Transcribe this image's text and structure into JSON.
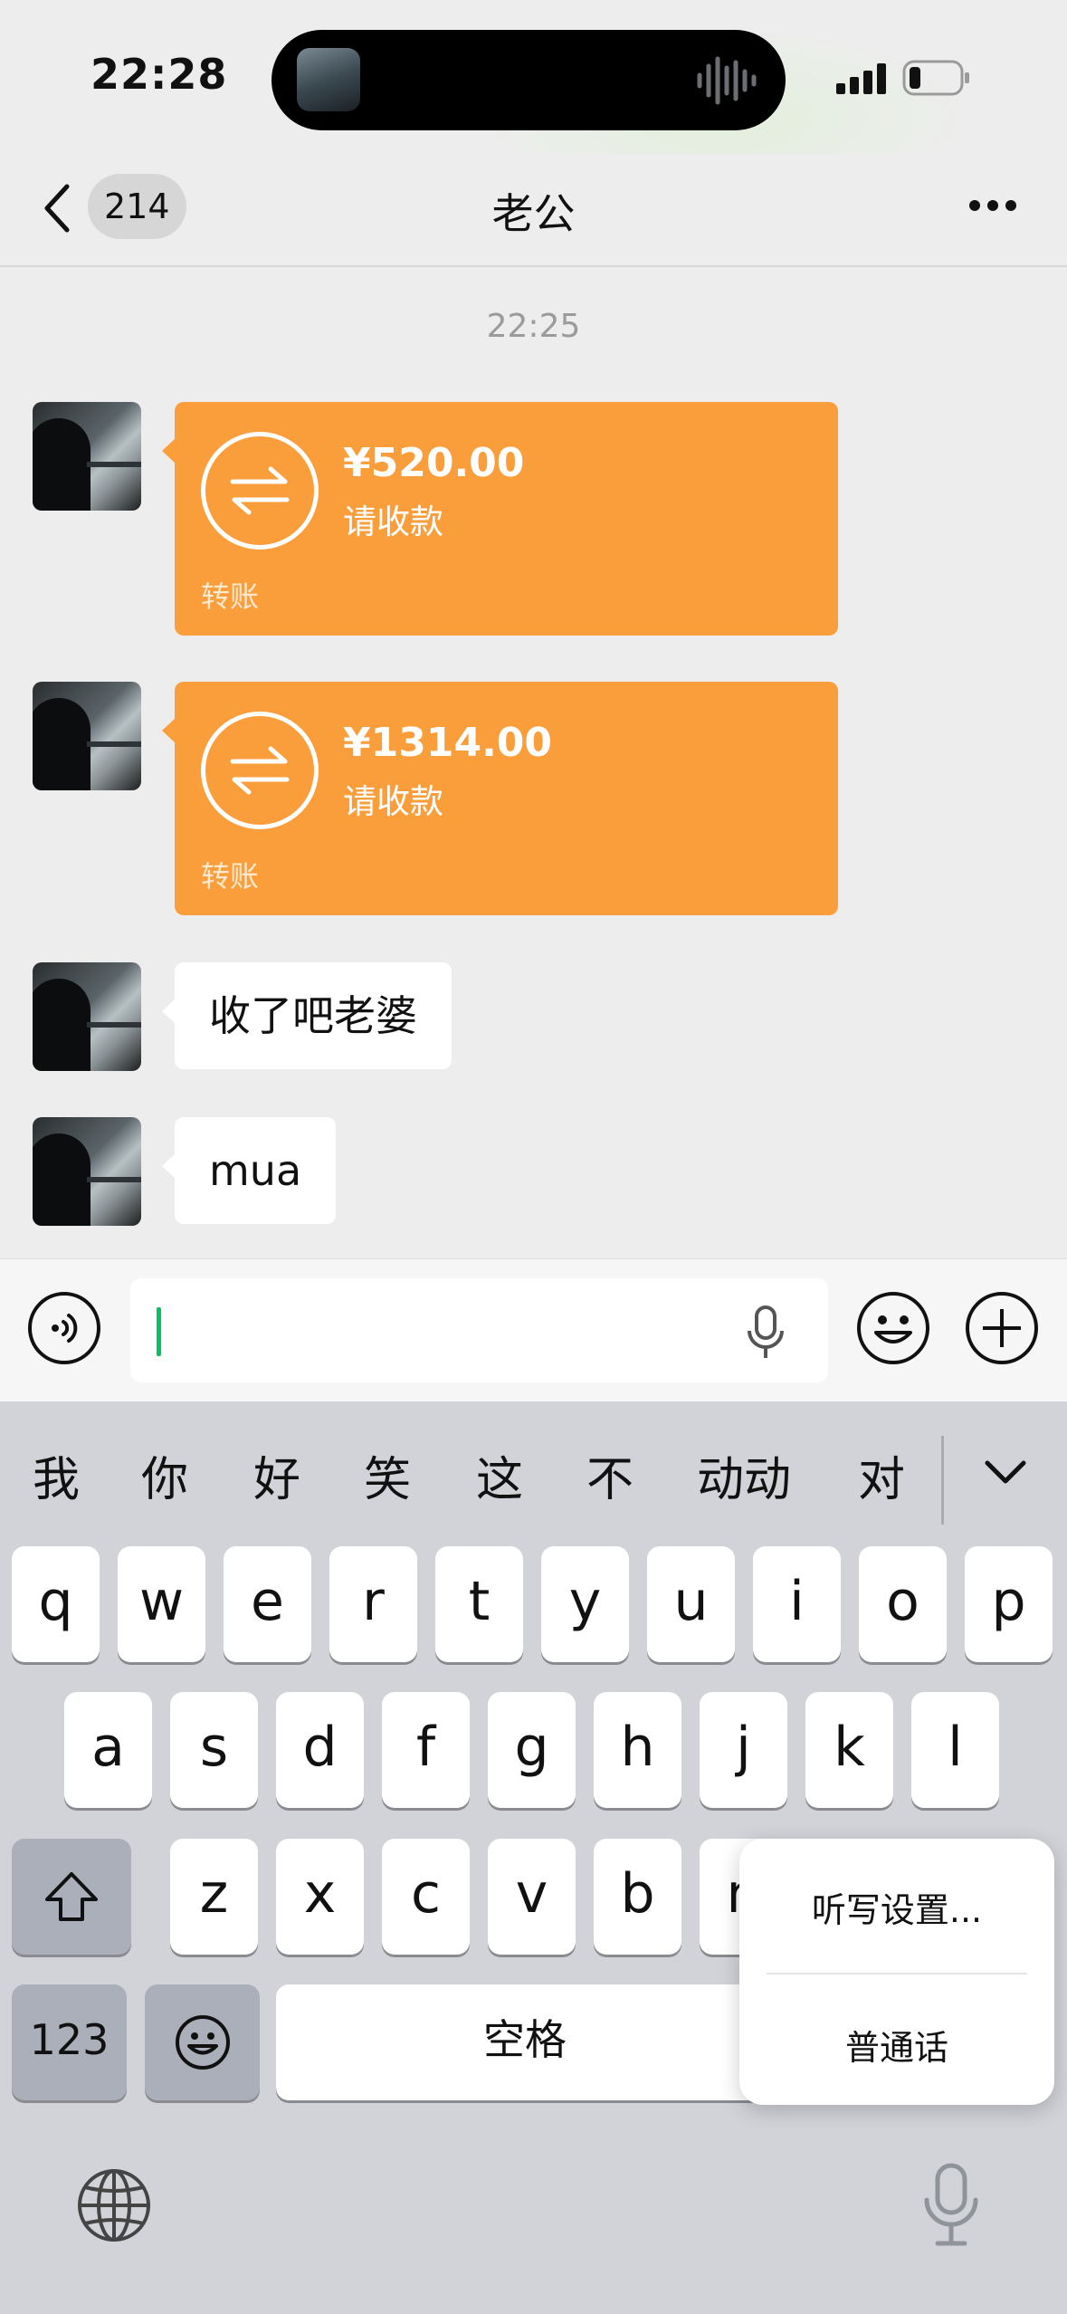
{
  "status_bar": {
    "time": "22:28"
  },
  "nav": {
    "unread_count": "214",
    "title": "老公"
  },
  "chat": {
    "timestamp": "22:25",
    "messages": [
      {
        "type": "transfer",
        "amount": "¥520.00",
        "status": "请收款",
        "label": "转账"
      },
      {
        "type": "transfer",
        "amount": "¥1314.00",
        "status": "请收款",
        "label": "转账"
      },
      {
        "type": "text",
        "text": "收了吧老婆"
      },
      {
        "type": "text",
        "text": "mua"
      }
    ]
  },
  "input": {
    "value": ""
  },
  "keyboard": {
    "candidates": [
      "我",
      "你",
      "好",
      "笑",
      "这",
      "不",
      "动动",
      "对"
    ],
    "row1": [
      "q",
      "w",
      "e",
      "r",
      "t",
      "y",
      "u",
      "i",
      "o",
      "p"
    ],
    "row2": [
      "a",
      "s",
      "d",
      "f",
      "g",
      "h",
      "j",
      "k",
      "l"
    ],
    "row3": [
      "z",
      "x",
      "c",
      "v",
      "b",
      "n"
    ],
    "numbers_key": "123",
    "space_key": "空格"
  },
  "dictation_popup": {
    "settings": "听写设置...",
    "language": "普通话"
  },
  "colors": {
    "transfer": "#fa9d3b",
    "caret": "#07c160",
    "background": "#ededed"
  }
}
